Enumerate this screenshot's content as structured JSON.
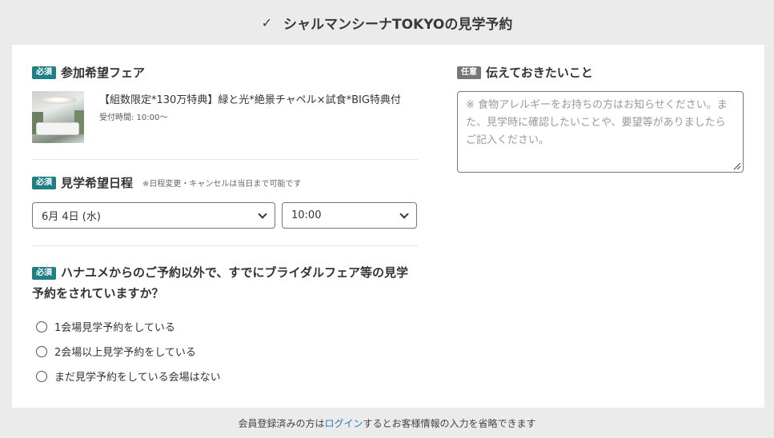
{
  "header": {
    "check_icon": "✓",
    "title": "シャルマンシーナTOKYOの見学予約"
  },
  "fair_section": {
    "badge": "必須",
    "title": "参加希望フェア",
    "fair_name": "【組数限定*130万特典】緑と光*絶景チャペル×試食*BIG特典付",
    "reception_time": "受付時間: 10:00～"
  },
  "date_section": {
    "badge": "必須",
    "title": "見学希望日程",
    "note": "※日程変更・キャンセルは当日まで可能です",
    "date_value": "6月 4日 (水)",
    "time_value": "10:00"
  },
  "question_section": {
    "badge": "必須",
    "title": "ハナユメからのご予約以外で、すでにブライダルフェア等の見学予約をされていますか？",
    "options": [
      "1会場見学予約をしている",
      "2会場以上見学予約をしている",
      "まだ見学予約をしている会場はない"
    ]
  },
  "memo_section": {
    "badge": "任意",
    "title": "伝えておきたいこと",
    "placeholder": "※ 食物アレルギーをお持ちの方はお知らせください。また、見学時に確認したいことや、要望等がありましたらご記入ください。"
  },
  "footer": {
    "prefix": "会員登録済みの方は",
    "login_link": "ログイン",
    "suffix": "するとお客様情報の入力を省略できます"
  },
  "colors": {
    "required_badge": "#1f7f86",
    "optional_badge": "#777777",
    "link": "#2a7ab8"
  }
}
